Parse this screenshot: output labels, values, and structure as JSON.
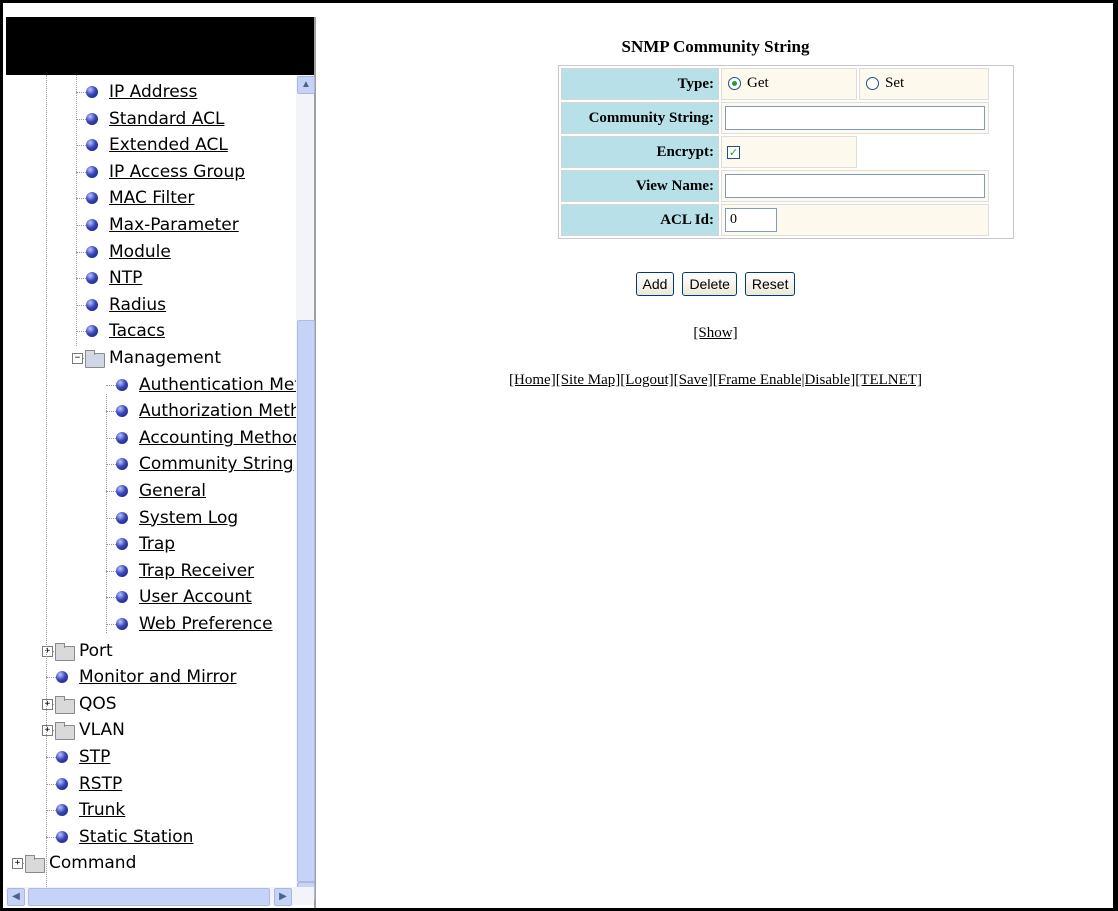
{
  "nav": {
    "tree": [
      {
        "label": "IP Address",
        "kind": "leaf",
        "link": true,
        "level": 2
      },
      {
        "label": "Standard ACL",
        "kind": "leaf",
        "link": true,
        "level": 2
      },
      {
        "label": "Extended ACL",
        "kind": "leaf",
        "link": true,
        "level": 2
      },
      {
        "label": "IP Access Group",
        "kind": "leaf",
        "link": true,
        "level": 2
      },
      {
        "label": "MAC Filter",
        "kind": "leaf",
        "link": true,
        "level": 2
      },
      {
        "label": "Max-Parameter",
        "kind": "leaf",
        "link": true,
        "level": 2
      },
      {
        "label": "Module",
        "kind": "leaf",
        "link": true,
        "level": 2
      },
      {
        "label": "NTP",
        "kind": "leaf",
        "link": true,
        "level": 2
      },
      {
        "label": "Radius",
        "kind": "leaf",
        "link": true,
        "level": 2
      },
      {
        "label": "Tacacs",
        "kind": "leaf",
        "link": true,
        "level": 2
      },
      {
        "label": "Management",
        "kind": "folder",
        "expanded": true,
        "level": 2
      },
      {
        "label": "Authentication Meth",
        "kind": "leaf",
        "link": true,
        "level": 3
      },
      {
        "label": "Authorization Metho",
        "kind": "leaf",
        "link": true,
        "level": 3
      },
      {
        "label": "Accounting Method",
        "kind": "leaf",
        "link": true,
        "level": 3
      },
      {
        "label": "Community String",
        "kind": "leaf",
        "link": true,
        "level": 3
      },
      {
        "label": "General",
        "kind": "leaf",
        "link": true,
        "level": 3
      },
      {
        "label": "System Log",
        "kind": "leaf",
        "link": true,
        "level": 3
      },
      {
        "label": "Trap",
        "kind": "leaf",
        "link": true,
        "level": 3
      },
      {
        "label": "Trap Receiver",
        "kind": "leaf",
        "link": true,
        "level": 3
      },
      {
        "label": "User Account",
        "kind": "leaf",
        "link": true,
        "level": 3
      },
      {
        "label": "Web Preference",
        "kind": "leaf",
        "link": true,
        "level": 3
      },
      {
        "label": "Port",
        "kind": "folder",
        "expanded": false,
        "level": 1
      },
      {
        "label": "Monitor and Mirror",
        "kind": "leaf",
        "link": true,
        "level": 1
      },
      {
        "label": "QOS",
        "kind": "folder",
        "expanded": false,
        "level": 1
      },
      {
        "label": "VLAN",
        "kind": "folder",
        "expanded": false,
        "level": 1
      },
      {
        "label": "STP",
        "kind": "leaf",
        "link": true,
        "level": 1
      },
      {
        "label": "RSTP",
        "kind": "leaf",
        "link": true,
        "level": 1
      },
      {
        "label": "Trunk",
        "kind": "leaf",
        "link": true,
        "level": 1
      },
      {
        "label": "Static Station",
        "kind": "leaf",
        "link": true,
        "level": 1
      },
      {
        "label": "Command",
        "kind": "folder",
        "expanded": false,
        "level": 0
      }
    ]
  },
  "form": {
    "title": "SNMP Community String",
    "type_label": "Type:",
    "type_options": [
      "Get",
      "Set"
    ],
    "type_selected": "Get",
    "community_label": "Community String:",
    "community_value": "",
    "encrypt_label": "Encrypt:",
    "encrypt_checked": true,
    "view_label": "View Name:",
    "view_value": "",
    "acl_label": "ACL Id:",
    "acl_value": "0"
  },
  "buttons": {
    "add": "Add",
    "delete": "Delete",
    "reset": "Reset"
  },
  "show_link": "[Show]",
  "footer_links": [
    "[Home]",
    "[Site Map]",
    "[Logout]",
    "[Save]",
    "[Frame Enable|Disable]",
    "[TELNET]"
  ],
  "icons": {
    "bullet": "blue-ball-icon",
    "folder": "folder-icon",
    "check": "checkmark-icon"
  }
}
